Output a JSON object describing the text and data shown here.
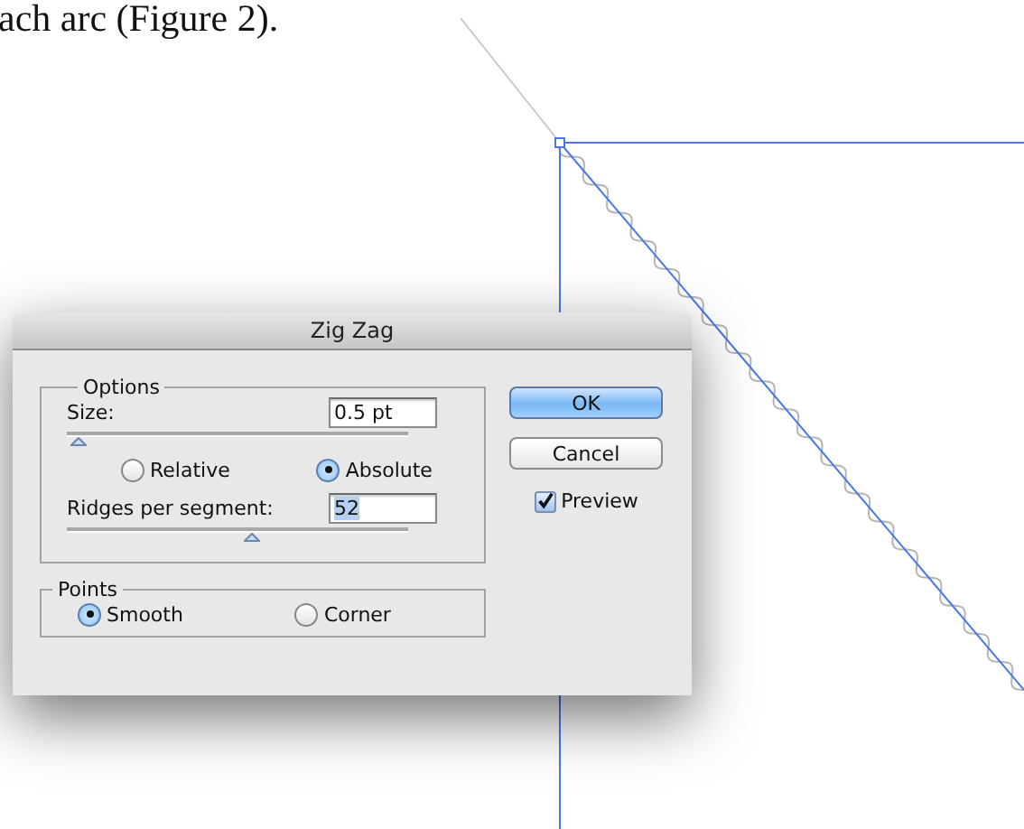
{
  "document_text": "ach arc (Figure 2).",
  "dialog": {
    "title": "Zig Zag",
    "options": {
      "label": "Options",
      "size": {
        "label": "Size:",
        "value": "0.5 pt",
        "level": 0.01,
        "value_selected": false
      },
      "mode": [
        {
          "label": "Relative",
          "selected": false
        },
        {
          "label": "Absolute",
          "selected": true
        }
      ],
      "ridges": {
        "label": "Ridges per segment:",
        "value": "52",
        "level": 0.52,
        "value_selected": true
      }
    },
    "points": {
      "label": "Points",
      "options": [
        {
          "label": "Smooth",
          "selected": true
        },
        {
          "label": "Corner",
          "selected": false
        }
      ]
    },
    "buttons": [
      {
        "label": "OK",
        "default": true
      },
      {
        "label": "Cancel",
        "default": false
      }
    ],
    "preview": {
      "label": "Preview",
      "checked": true
    }
  }
}
